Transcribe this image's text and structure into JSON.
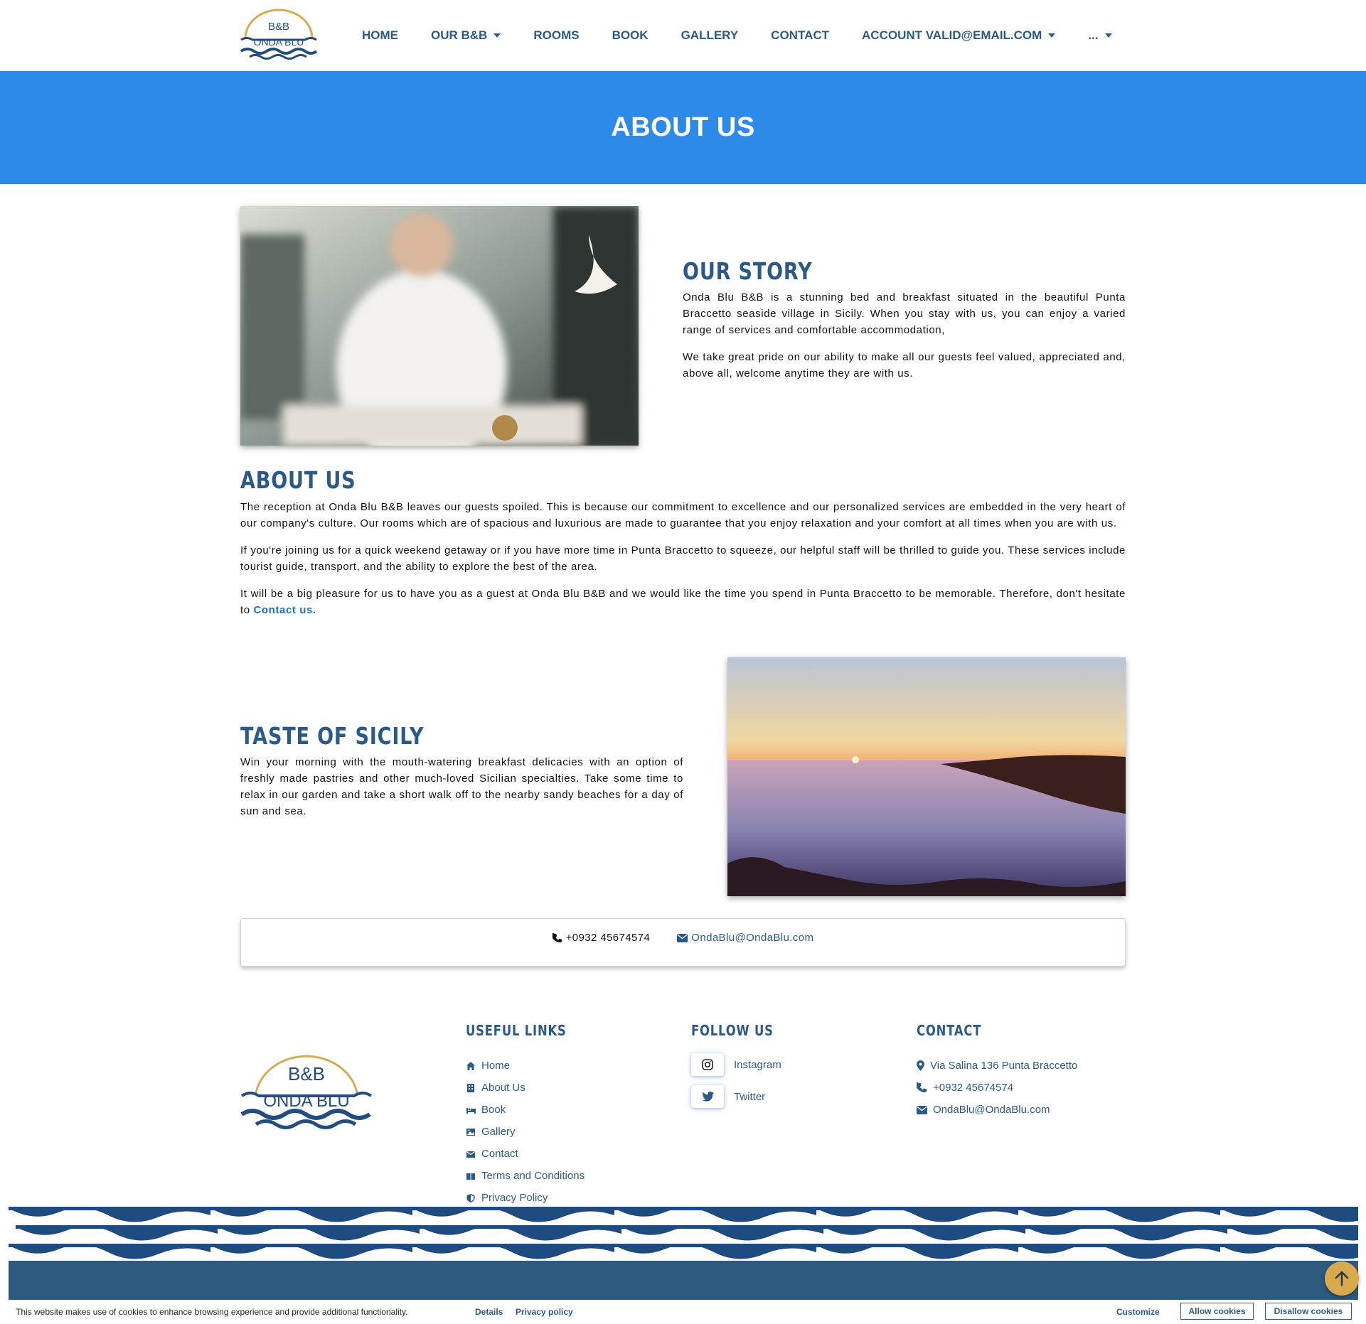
{
  "nav": {
    "items": [
      {
        "label": "HOME",
        "dropdown": false
      },
      {
        "label": "OUR B&B",
        "dropdown": true
      },
      {
        "label": "ROOMS",
        "dropdown": false
      },
      {
        "label": "BOOK",
        "dropdown": false
      },
      {
        "label": "GALLERY",
        "dropdown": false
      },
      {
        "label": "CONTACT",
        "dropdown": false
      },
      {
        "label": "ACCOUNT VALID@EMAIL.COM",
        "dropdown": true
      },
      {
        "label": "...",
        "dropdown": true
      }
    ]
  },
  "logo": {
    "line1": "B&B",
    "line2": "ONDA BLU"
  },
  "hero": {
    "title": "ABOUT US"
  },
  "story": {
    "heading": "OUR STORY",
    "p1": "Onda Blu B&B is a stunning bed and breakfast situated in the beautiful Punta Braccetto seaside village in Sicily. When you stay with us, you can enjoy a varied range of services and comfortable accommodation,",
    "p2": "We take great pride on our ability to make all our guests feel valued, appreciated and, above all, welcome anytime they are with us."
  },
  "about": {
    "heading": "ABOUT US",
    "p1": "The reception at Onda Blu B&B leaves our guests spoiled. This is because our commitment to excellence and our personalized services are embedded in the very heart of our company's culture. Our rooms which are of spacious and luxurious are made to guarantee that you enjoy relaxation and your comfort at all times when you are with us.",
    "p2": "If you're joining us for a quick weekend getaway or if you have more time in Punta Braccetto to squeeze, our helpful staff will be thrilled to guide you. These services include tourist guide, transport, and the ability to explore the best of the area.",
    "p3": "It will be a big pleasure for us to have you as a guest at Onda Blu B&B and we would like the time you spend in Punta Braccetto to be memorable. Therefore, don't hesitate to ",
    "p3_link": "Contact us."
  },
  "taste": {
    "heading": "TASTE OF SICILY",
    "p1": "Win your morning with the mouth-watering breakfast delicacies with an option of freshly made pastries and other much-loved Sicilian specialties. Take some time to relax in our garden and take a short walk off to the nearby sandy beaches for a day of sun and sea."
  },
  "contact_bar": {
    "phone": "+0932 45674574",
    "email": "OndaBlu@OndaBlu.com"
  },
  "footer": {
    "useful_links_title": "USEFUL LINKS",
    "useful_links": [
      {
        "label": "Home",
        "icon": "home-icon"
      },
      {
        "label": "About Us",
        "icon": "building-icon"
      },
      {
        "label": "Book",
        "icon": "bed-icon"
      },
      {
        "label": "Gallery",
        "icon": "image-icon"
      },
      {
        "label": "Contact",
        "icon": "envelope-icon"
      },
      {
        "label": "Terms and Conditions",
        "icon": "book-icon"
      },
      {
        "label": "Privacy Policy",
        "icon": "shield-icon"
      }
    ],
    "follow_title": "FOLLOW US",
    "social": [
      {
        "label": "Instagram",
        "icon": "instagram-icon"
      },
      {
        "label": "Twitter",
        "icon": "twitter-icon"
      }
    ],
    "contact_title": "CONTACT",
    "address": "Via Salina 136 Punta Braccetto",
    "phone": "+0932 45674574",
    "email": "OndaBlu@OndaBlu.com"
  },
  "cookie": {
    "text": "This website makes use of cookies to enhance browsing experience and provide additional functionality.",
    "details": "Details",
    "privacy": "Privacy policy",
    "customize": "Customize",
    "allow": "Allow cookies",
    "disallow": "Disallow cookies"
  },
  "colors": {
    "brand_blue": "#2c5a87",
    "hero_blue": "#2e8ae8",
    "gold": "#d9a94e",
    "footer_band": "#2e5a80"
  }
}
